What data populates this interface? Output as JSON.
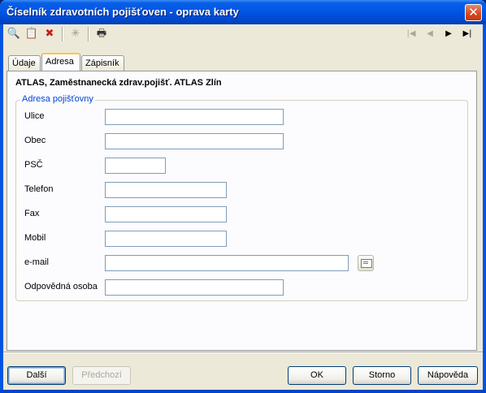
{
  "window": {
    "title": "Číselník zdravotních pojišťoven - oprava karty",
    "close_glyph": "✕"
  },
  "toolbar": {
    "icons": [
      "binoculars-icon",
      "copy-icon",
      "delete-icon",
      "new-record-icon",
      "print-icon"
    ],
    "glyphs": [
      "🔍",
      "📋",
      "✖",
      "✳",
      "🖶"
    ],
    "nav": {
      "first": "|◀",
      "prev": "◀",
      "next": "▶",
      "last": "▶|"
    }
  },
  "tabs": [
    {
      "label": "Údaje"
    },
    {
      "label": "Adresa"
    },
    {
      "label": "Zápisník"
    }
  ],
  "content": {
    "heading": "ATLAS, Zaměstnanecká zdrav.pojišť. ATLAS Zlín",
    "group_label": "Adresa pojišťovny",
    "fields": [
      {
        "label": "Ulice",
        "value": ""
      },
      {
        "label": "Obec",
        "value": ""
      },
      {
        "label": "PSČ",
        "value": ""
      },
      {
        "label": "Telefon",
        "value": ""
      },
      {
        "label": "Fax",
        "value": ""
      },
      {
        "label": "Mobil",
        "value": ""
      },
      {
        "label": "e-mail",
        "value": ""
      },
      {
        "label": "Odpovědná osoba",
        "value": ""
      }
    ]
  },
  "buttons": {
    "next": "Další",
    "prev": "Předchozí",
    "ok": "OK",
    "cancel": "Storno",
    "help": "Nápověda"
  }
}
